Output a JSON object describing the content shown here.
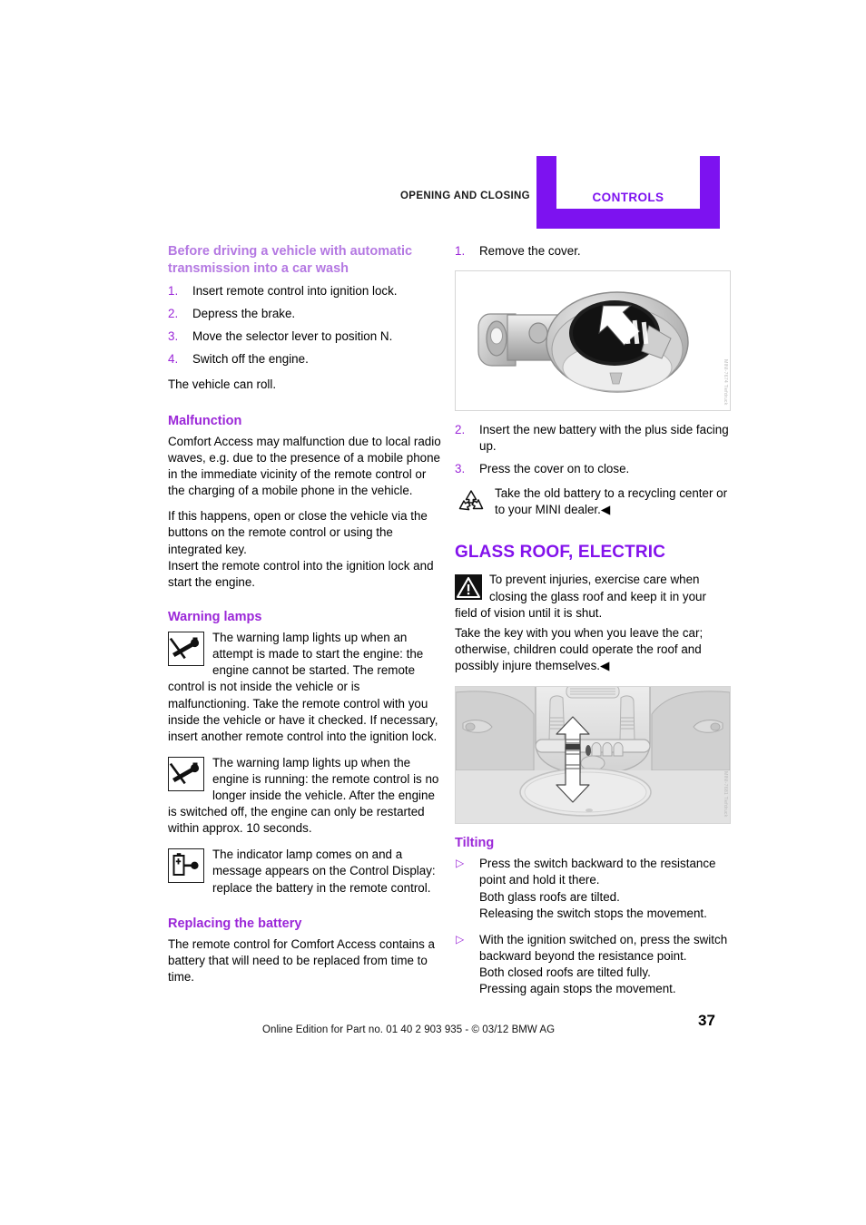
{
  "header": {
    "left_label": "OPENING AND CLOSING",
    "right_label": "CONTROLS",
    "accent_color": "#7d12f0"
  },
  "colors": {
    "section_heading": "#8312ec",
    "sub_heading": "#9b27d8",
    "sub_sub_heading": "#b478e2",
    "body_text": "#000000"
  },
  "left_column": {
    "carwash": {
      "heading": "Before driving a vehicle with automatic transmission into a car wash",
      "steps": [
        {
          "num": "1.",
          "text": "Insert remote control into ignition lock."
        },
        {
          "num": "2.",
          "text": "Depress the brake."
        },
        {
          "num": "3.",
          "text": "Move the selector lever to position N."
        },
        {
          "num": "4.",
          "text": "Switch off the engine."
        }
      ],
      "after_text": "The vehicle can roll."
    },
    "malfunction": {
      "heading": "Malfunction",
      "paragraph_1": "Comfort Access may malfunction due to local radio waves, e.g. due to the presence of a mobile phone in the immediate vicinity of the remote control or the charging of a mobile phone in the vehicle.",
      "paragraph_2": "If this happens, open or close the vehicle via the buttons on the remote control or using the integrated key.",
      "paragraph_3": "Insert the remote control into the ignition lock and start the engine."
    },
    "warning_lamps": {
      "heading": "Warning lamps",
      "items": [
        {
          "icon": "key-crossed-out-icon",
          "text": "The warning lamp lights up when an attempt is made to start the engine: the engine cannot be started. The remote control is not inside the vehicle or is malfunctioning. Take the remote control with you inside the vehicle or have it checked. If necessary, insert another remote control into the ignition lock."
        },
        {
          "icon": "key-crossed-out-icon",
          "text": "The warning lamp lights up when the engine is running: the remote control is no longer inside the vehicle. After the engine is switched off, the engine can only be restarted within approx. 10 seconds."
        },
        {
          "icon": "battery-key-icon",
          "text": "The indicator lamp comes on and a message appears on the Control Display: replace the battery in the remote control."
        }
      ]
    },
    "replacing_battery": {
      "heading": "Replacing the battery",
      "paragraph": "The remote control for Comfort Access contains a battery that will need to be replaced from time to time."
    }
  },
  "right_column": {
    "battery_steps": {
      "step_1": {
        "num": "1.",
        "text": "Remove the cover."
      },
      "figure_1": {
        "name": "key-fob-battery-illustration",
        "caption": "MINI-7674 Tiefdruck"
      },
      "step_2": {
        "num": "2.",
        "text": "Insert the new battery with the plus side facing up."
      },
      "step_3": {
        "num": "3.",
        "text": "Press the cover on to close."
      },
      "recycling_note": {
        "icon": "recycling-icon",
        "text": "Take the old battery to a recycling center or to your MINI dealer.",
        "end_mark": "◀"
      }
    },
    "glass_roof": {
      "heading": "GLASS ROOF, ELECTRIC",
      "warning": {
        "icon": "warning-triangle-icon",
        "paragraph_1": "To prevent injuries, exercise care when closing the glass roof and keep it in your field of vision until it is shut.",
        "paragraph_2": "Take the key with you when you leave the car; otherwise, children could operate the roof and possibly injure themselves.",
        "end_mark": "◀"
      },
      "figure_2": {
        "name": "roof-console-switch-illustration",
        "caption": "MINI-7681 Tiefdruck"
      },
      "tilting": {
        "heading": "Tilting",
        "bullets": [
          {
            "marker": "▷",
            "lines": [
              "Press the switch backward to the resistance point and hold it there.",
              "Both glass roofs are tilted.",
              "Releasing the switch stops the movement."
            ]
          },
          {
            "marker": "▷",
            "lines": [
              "With the ignition switched on, press the switch backward beyond the resistance point.",
              "Both closed roofs are tilted fully.",
              "Pressing again stops the movement."
            ]
          }
        ]
      }
    }
  },
  "footer": {
    "text": "Online Edition for Part no. 01 40 2 903 935 - © 03/12 BMW AG",
    "page_number": "37"
  }
}
